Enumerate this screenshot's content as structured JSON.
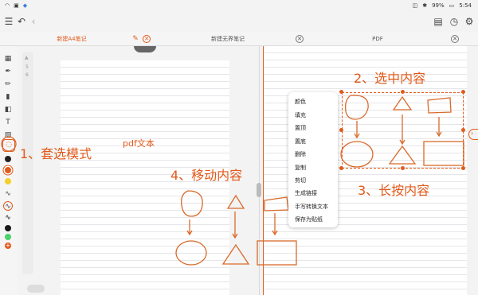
{
  "status": {
    "time": "5:54",
    "battery": "99%"
  },
  "tabs": [
    {
      "label": "新建A4笔记"
    },
    {
      "label": "新建无界笔记"
    },
    {
      "label": "PDF"
    }
  ],
  "page_numbers": {
    "current": "5",
    "total": "6"
  },
  "menu_items": [
    "颜色",
    "填充",
    "置顶",
    "置底",
    "删除",
    "复制",
    "剪切",
    "生成链接",
    "手写转换文本",
    "保存为贴纸"
  ],
  "annotations": {
    "step1": "1、套选模式",
    "pdf_text": "pdf文本",
    "step2": "2、选中内容",
    "step3": "3、长按内容",
    "step4": "4、移动内容"
  },
  "colors": {
    "accent": "#e25a1a",
    "ink": "#d96a2a"
  }
}
